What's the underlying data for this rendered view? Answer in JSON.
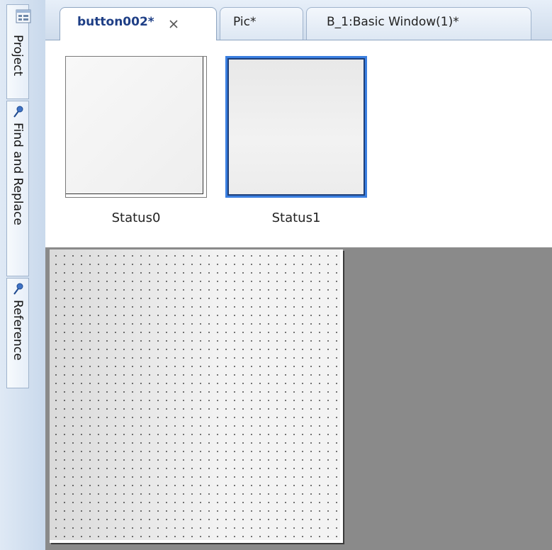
{
  "dock": {
    "items": [
      {
        "label": "Project"
      },
      {
        "label": "Find and Replace"
      },
      {
        "label": "Reference"
      }
    ]
  },
  "tabs": [
    {
      "label": "button002*",
      "active": true
    },
    {
      "label": "Pic*",
      "active": false
    },
    {
      "label": "B_1:Basic Window(1)*",
      "active": false
    }
  ],
  "statuses": [
    {
      "caption": "Status0",
      "selected": false
    },
    {
      "caption": "Status1",
      "selected": true
    }
  ],
  "colors": {
    "active_tab_text": "#1f3f86",
    "selection_border": "#3b7fe0",
    "canvas_background": "#8a8a8a"
  }
}
